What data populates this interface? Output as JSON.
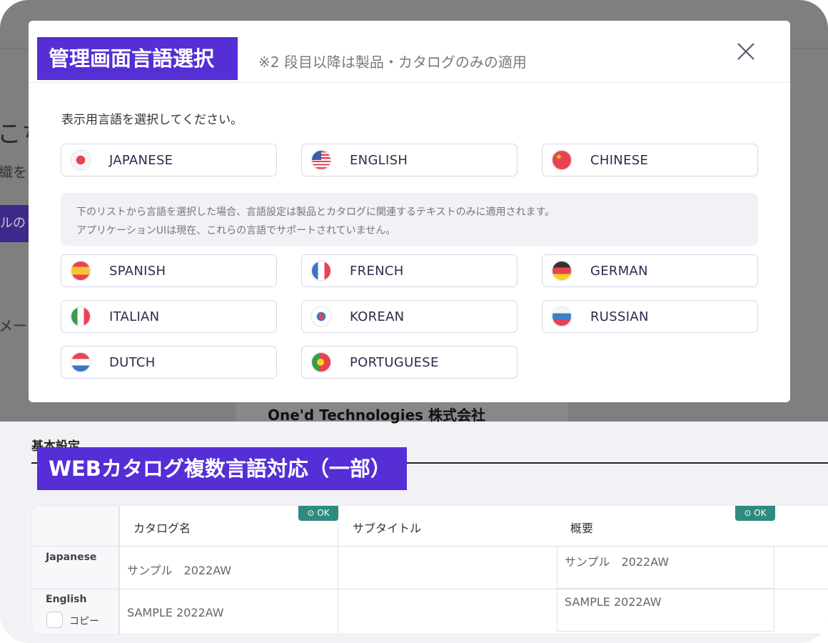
{
  "background": {
    "fragments": [
      "こち",
      "織を",
      "ルの",
      "メー"
    ],
    "company": "One'd Technologies 株式会社",
    "section": "基本設定"
  },
  "modal": {
    "title": "管理画面言語選択",
    "note": "※2 段目以降は製品・カタログのみの適用",
    "close_icon": "close-icon",
    "prompt": "表示用言語を選択してください。",
    "primary_languages": [
      {
        "label": "JAPANESE",
        "flag": "jp"
      },
      {
        "label": "ENGLISH",
        "flag": "us"
      },
      {
        "label": "CHINESE",
        "flag": "cn"
      }
    ],
    "info_lines": [
      "下のリストから言語を選択した場合、言語設定は製品とカタログに関連するテキストのみに適用されます。",
      "アプリケーションUIは現在、これらの言語でサポートされていません。"
    ],
    "other_languages": [
      {
        "label": "SPANISH",
        "flag": "es"
      },
      {
        "label": "FRENCH",
        "flag": "fr"
      },
      {
        "label": "GERMAN",
        "flag": "de"
      },
      {
        "label": "ITALIAN",
        "flag": "it"
      },
      {
        "label": "KOREAN",
        "flag": "kr"
      },
      {
        "label": "RUSSIAN",
        "flag": "ru"
      },
      {
        "label": "DUTCH",
        "flag": "nl"
      },
      {
        "label": "PORTUGUESE",
        "flag": "pt"
      }
    ]
  },
  "catalog": {
    "badge": "WEBカタログ複数言語対応（一部）",
    "columns": [
      "カタログ名",
      "サブタイトル",
      "概要"
    ],
    "ok_label": "OK",
    "rows": [
      {
        "lang": "Japanese",
        "name": "サンプル　2022AW",
        "subtitle": "",
        "summary": "サンプル　2022AW"
      },
      {
        "lang": "English",
        "copy_label": "コピー",
        "name": "SAMPLE 2022AW",
        "subtitle": "",
        "summary": "SAMPLE 2022AW"
      }
    ]
  },
  "colors": {
    "accent": "#552ed6",
    "ok": "#2f8a80",
    "overlay": "#7f7f7f"
  }
}
